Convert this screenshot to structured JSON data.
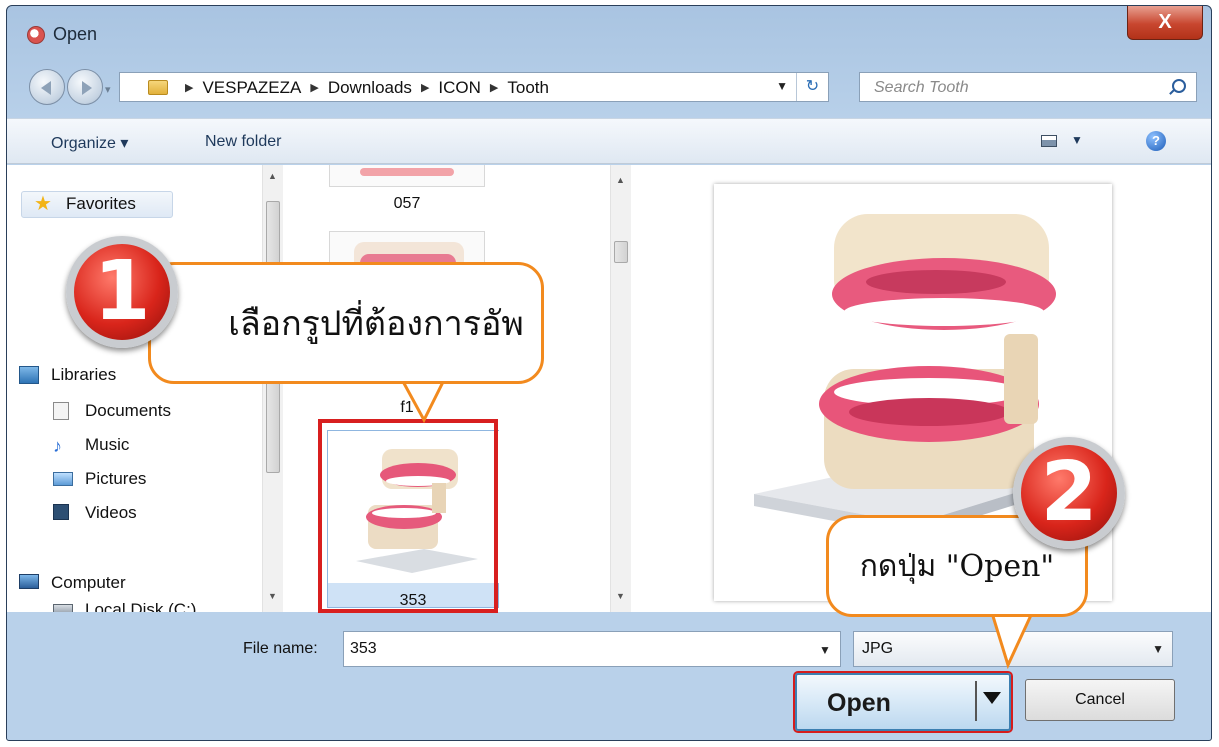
{
  "window": {
    "title": "Open",
    "close_label": "X"
  },
  "nav": {
    "breadcrumbs": [
      "VESPAZEZA",
      "Downloads",
      "ICON",
      "Tooth"
    ],
    "search_placeholder": "Search Tooth"
  },
  "toolbar": {
    "organize": "Organize ▾",
    "new_folder": "New folder",
    "help": "?"
  },
  "sidebar": {
    "favorites": "Favorites",
    "libraries": "Libraries",
    "items": [
      "Documents",
      "Music",
      "Pictures",
      "Videos"
    ],
    "computer": "Computer",
    "local_disk": "Local Disk (C:)"
  },
  "files": [
    {
      "name": "057"
    },
    {
      "name": "f1"
    },
    {
      "name": "353",
      "selected": true
    }
  ],
  "bottom": {
    "file_name_label": "File name:",
    "file_name_value": "353",
    "file_type": "JPG",
    "open_label": "Open",
    "cancel_label": "Cancel"
  },
  "annotations": {
    "step1": {
      "number": "1",
      "text": "เลือกรูปที่ต้องการอัพ"
    },
    "step2": {
      "number": "2",
      "text": "กดปุ่ม \"Open\""
    },
    "highlight_color": "#d81f1f",
    "bubble_border": "#f28a1e"
  }
}
